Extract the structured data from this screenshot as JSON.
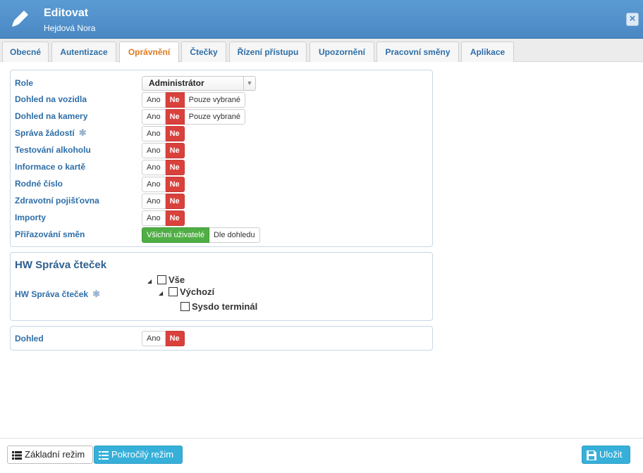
{
  "header": {
    "title": "Editovat",
    "subtitle": "Hejdová Nora",
    "close_icon": "close-icon"
  },
  "tabs": [
    {
      "label": "Obecné",
      "active": false
    },
    {
      "label": "Autentizace",
      "active": false
    },
    {
      "label": "Oprávnění",
      "active": true
    },
    {
      "label": "Čtečky",
      "active": false
    },
    {
      "label": "Řízení přístupu",
      "active": false
    },
    {
      "label": "Upozornění",
      "active": false
    },
    {
      "label": "Pracovní směny",
      "active": false
    },
    {
      "label": "Aplikace",
      "active": false
    }
  ],
  "permissions": {
    "role_label": "Role",
    "role_value": "Administrátor",
    "rows": [
      {
        "label": "Dohled na vozidla",
        "options": [
          "Ano",
          "Ne",
          "Pouze vybrané"
        ],
        "selected": "Ne"
      },
      {
        "label": "Dohled na kamery",
        "options": [
          "Ano",
          "Ne",
          "Pouze vybrané"
        ],
        "selected": "Ne"
      },
      {
        "label": "Správa žádostí",
        "options": [
          "Ano",
          "Ne"
        ],
        "selected": "Ne"
      },
      {
        "label": "Testování alkoholu",
        "options": [
          "Ano",
          "Ne"
        ],
        "selected": "Ne"
      },
      {
        "label": "Informace o kartě",
        "options": [
          "Ano",
          "Ne"
        ],
        "selected": "Ne"
      },
      {
        "label": "Rodné číslo",
        "options": [
          "Ano",
          "Ne"
        ],
        "selected": "Ne"
      },
      {
        "label": "Zdravotní pojišťovna",
        "options": [
          "Ano",
          "Ne"
        ],
        "selected": "Ne"
      },
      {
        "label": "Importy",
        "options": [
          "Ano",
          "Ne"
        ],
        "selected": "Ne"
      },
      {
        "label": "Přiřazování směn",
        "options": [
          "Všichni uživatelé",
          "Dle dohledu"
        ],
        "selected": "Všichni uživatelé"
      }
    ]
  },
  "hw_section": {
    "title": "HW Správa čteček",
    "field_label": "HW Správa čteček",
    "tree": [
      {
        "label": "Vše"
      },
      {
        "label": "Výchozí"
      },
      {
        "label": "Sysdo terminál"
      }
    ]
  },
  "dohled": {
    "label": "Dohled",
    "options": [
      "Ano",
      "Ne"
    ],
    "selected": "Ne"
  },
  "footer": {
    "basic_mode": "Základní režim",
    "advanced_mode": "Pokročilý režim",
    "save": "Uložit"
  },
  "colors": {
    "header": "#4a88c4",
    "active_tab": "#e07b1f",
    "no_red": "#d9413c",
    "green": "#4fae44",
    "cyan_button": "#36b0d9"
  }
}
